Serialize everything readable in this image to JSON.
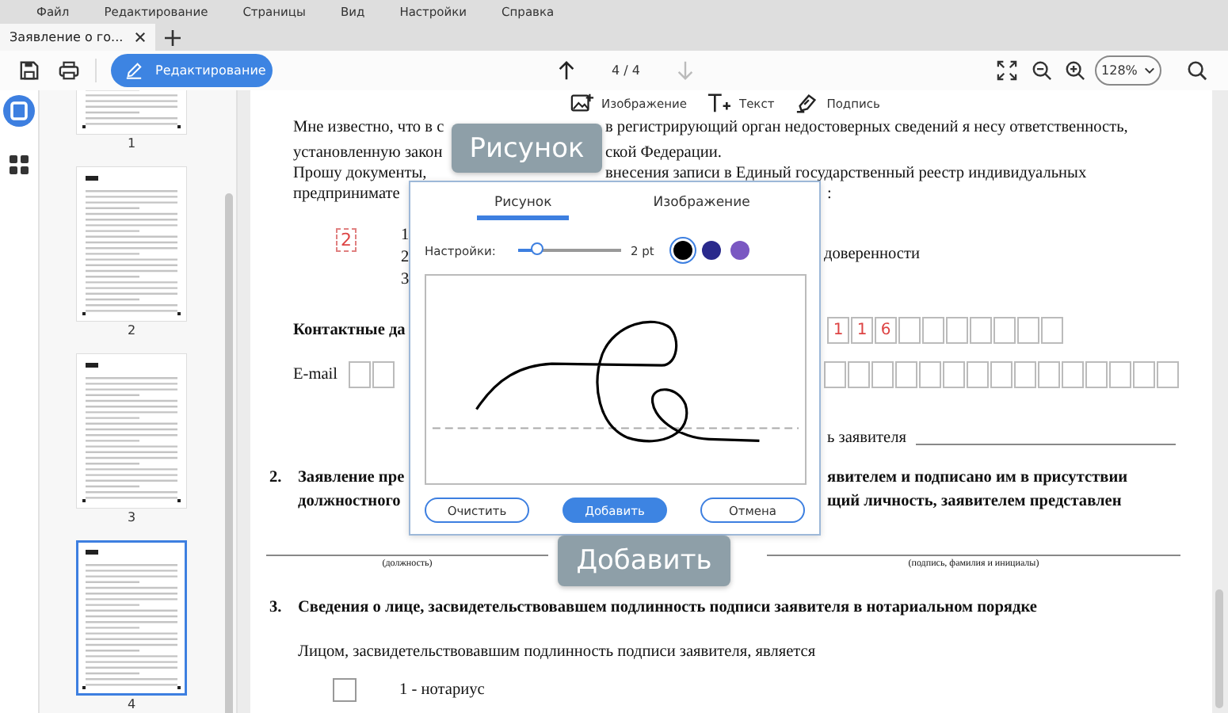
{
  "menu": [
    "Файл",
    "Редактирование",
    "Страницы",
    "Вид",
    "Настройки",
    "Справка"
  ],
  "tabs": [
    {
      "label": "Заявление о го...",
      "selected": true
    }
  ],
  "toolbar": {
    "edit_button": "Редактирование",
    "page_indicator": "4 / 4",
    "zoom": "128%"
  },
  "annotation_tools": [
    "Изображение",
    "Текст",
    "Подпись"
  ],
  "thumbnails": [
    {
      "label": "1",
      "selected": false
    },
    {
      "label": "2",
      "selected": false
    },
    {
      "label": "3",
      "selected": false
    },
    {
      "label": "4",
      "selected": true
    }
  ],
  "document": {
    "notice": [
      {
        "left": "Мне известно, что в с",
        "right": "в регистрирующий орган недостоверных сведений я несу ответственность,"
      },
      {
        "left": "установленную закон",
        "right": "ской Федерации."
      }
    ],
    "request": [
      {
        "left": "Прошу документы,",
        "right": "внесения записи в Единый государственный реестр индивидуальных"
      },
      {
        "left": "предпринимате",
        "right": ":"
      }
    ],
    "marked_number": "2",
    "options": [
      "1",
      "2",
      "3"
    ],
    "option_2_right": "доверенности",
    "contacts_label": "Контактные да",
    "phone_digits": [
      "1",
      "1",
      "6"
    ],
    "email_label": "E-mail",
    "signature_label": "ь заявителя",
    "section_2": {
      "number": "2.",
      "lines": [
        {
          "left": "Заявление пре",
          "right": "явителем и подписано им в присутствии"
        },
        {
          "left": "должностного",
          "right": "щий личность, заявителем представлен"
        }
      ]
    },
    "captions": [
      "(должность)",
      "(подпись, фамилия и инициалы)"
    ],
    "section_3": {
      "number": "3.",
      "title": "Сведения о лице, засвидетельствовавшем подлинность подписи заявителя в нотариальном порядке"
    },
    "statement": "Лицом, засвидетельствовавшим подлинность подписи заявителя, является",
    "choices": [
      {
        "label": "1 - нотариус",
        "checked": false
      }
    ]
  },
  "dialog": {
    "tabs": [
      {
        "label": "Рисунок",
        "selected": true
      },
      {
        "label": "Изображение",
        "selected": false
      }
    ],
    "settings_label": "Настройки:",
    "thickness": {
      "level": 0.18,
      "reading": "2 pt"
    },
    "colors": [
      {
        "color": "#000000",
        "selected": true
      },
      {
        "color": "#2a2a8c",
        "selected": false
      },
      {
        "color": "#7a58c2",
        "selected": false
      }
    ],
    "buttons": [
      {
        "label": "Очистить",
        "kind": "outline"
      },
      {
        "label": "Добавить",
        "kind": "primary"
      },
      {
        "label": "Отмена",
        "kind": "outline"
      }
    ]
  },
  "tooltips": {
    "draw_tab": "Рисунок",
    "add_button": "Добавить"
  }
}
